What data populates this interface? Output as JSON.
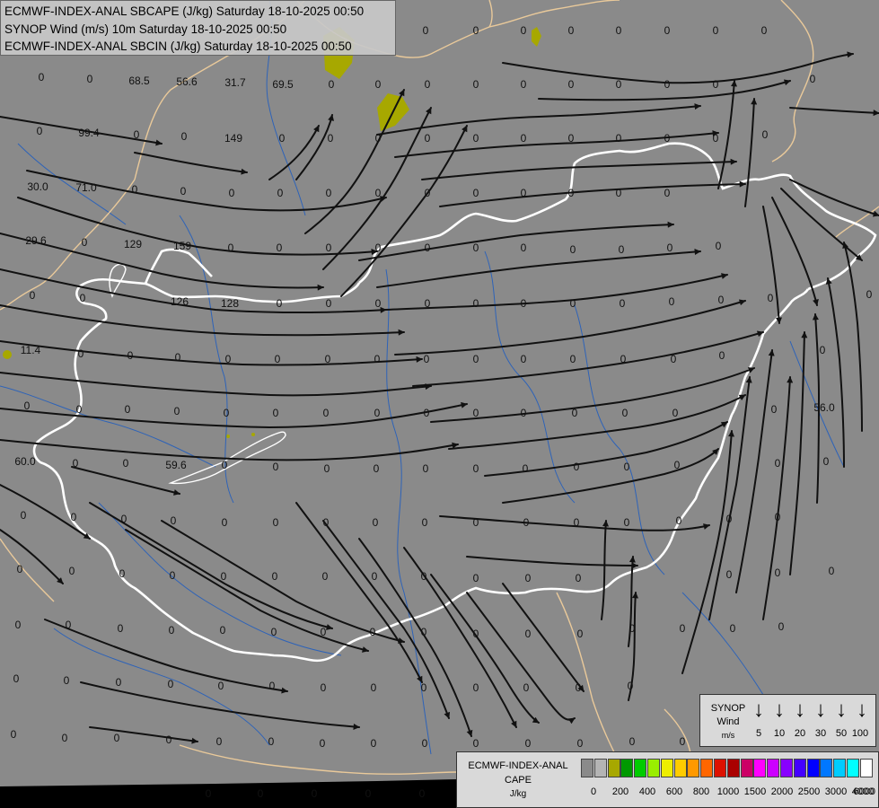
{
  "header": {
    "line1": "ECMWF-INDEX-ANAL SBCAPE (J/kg) Saturday 18-10-2025 00:50",
    "line2": "SYNOP Wind (m/s) 10m Saturday 18-10-2025 00:50",
    "line3": "ECMWF-INDEX-ANAL SBCIN (J/kg) Saturday 18-10-2025 00:50"
  },
  "colors": {
    "map_background": "#8a8a8a",
    "streamlines": "#111111",
    "country_border": "#ffffff",
    "regional_border": "#e9c99a",
    "rivers": "#2e63b8",
    "cape_patch": "#a7a800"
  },
  "map_values": [
    "0",
    "0",
    "0",
    "0",
    "0",
    "0",
    "0",
    "0",
    "0",
    "0",
    "68.5",
    "56.6",
    "31.7",
    "69.5",
    "0",
    "0",
    "0",
    "0",
    "0",
    "0",
    "0",
    "0",
    "0",
    "0",
    "0",
    "99.4",
    "0",
    "0",
    "149",
    "0",
    "0",
    "0",
    "0",
    "0",
    "0",
    "0",
    "0",
    "0",
    "0",
    "0",
    "30.0",
    "71.0",
    "0",
    "0",
    "0",
    "0",
    "0",
    "0",
    "0",
    "0",
    "0",
    "0",
    "0",
    "0",
    "29.6",
    "0",
    "129",
    "159",
    "0",
    "0",
    "0",
    "0",
    "0",
    "0",
    "0",
    "0",
    "0",
    "0",
    "0",
    "0",
    "0",
    "126",
    "128",
    "0",
    "0",
    "0",
    "0",
    "0",
    "0",
    "0",
    "0",
    "0",
    "0",
    "0",
    "0",
    "11.4",
    "0",
    "0",
    "0",
    "0",
    "0",
    "0",
    "0",
    "0",
    "0",
    "0",
    "0",
    "0",
    "0",
    "0",
    "0",
    "0",
    "0",
    "0",
    "0",
    "0",
    "0",
    "0",
    "0",
    "0",
    "0",
    "0",
    "0",
    "0",
    "0",
    "0",
    "56.0",
    "60.0",
    "0",
    "0",
    "59.6",
    "0",
    "0",
    "0",
    "0",
    "0",
    "0",
    "0",
    "0",
    "0",
    "0",
    "0",
    "0",
    "0",
    "0",
    "0",
    "0",
    "0",
    "0",
    "0",
    "0",
    "0",
    "0",
    "0",
    "0",
    "0",
    "0",
    "0",
    "0",
    "0",
    "0",
    "0",
    "0",
    "0",
    "0",
    "0",
    "0",
    "0",
    "0",
    "0",
    "0",
    "0",
    "0",
    "0",
    "0",
    "0",
    "0",
    "0",
    "0",
    "0",
    "0",
    "0",
    "0",
    "0",
    "0",
    "0",
    "0",
    "0",
    "0",
    "0",
    "0",
    "0",
    "0",
    "0",
    "0",
    "0",
    "0",
    "0",
    "0",
    "0",
    "0",
    "0",
    "0",
    "0",
    "0",
    "0",
    "0",
    "0",
    "0",
    "0",
    "0",
    "0",
    "0",
    "0",
    "0",
    "0",
    "0",
    "0",
    "0",
    "0",
    "0",
    "0",
    "0",
    "0",
    "0",
    "0",
    "0",
    "0",
    "0",
    "0",
    "0",
    "0",
    "0",
    "0"
  ],
  "wind_legend": {
    "title": "SYNOP",
    "subtitle": "Wind",
    "unit": "m/s",
    "speeds": [
      "5",
      "10",
      "20",
      "30",
      "50",
      "100"
    ]
  },
  "cape_legend": {
    "title": "ECMWF-INDEX-ANAL",
    "subtitle": "CAPE",
    "unit": "J/kg",
    "swatches": [
      "#8a8a8a",
      "#b4b4b4",
      "#a7a800",
      "#009900",
      "#00cc00",
      "#99ee00",
      "#eeee00",
      "#ffcc00",
      "#ff9900",
      "#ff6600",
      "#dd1100",
      "#aa0000",
      "#cc0066",
      "#ff00ff",
      "#cc00ff",
      "#8800ff",
      "#4400ff",
      "#0000ff",
      "#0077ff",
      "#00ccff",
      "#00ffff",
      "#ffffff"
    ],
    "ticks": [
      "0",
      "200",
      "400",
      "600",
      "800",
      "1000",
      "1500",
      "2000",
      "2500",
      "3000",
      "4000",
      "6000"
    ]
  }
}
